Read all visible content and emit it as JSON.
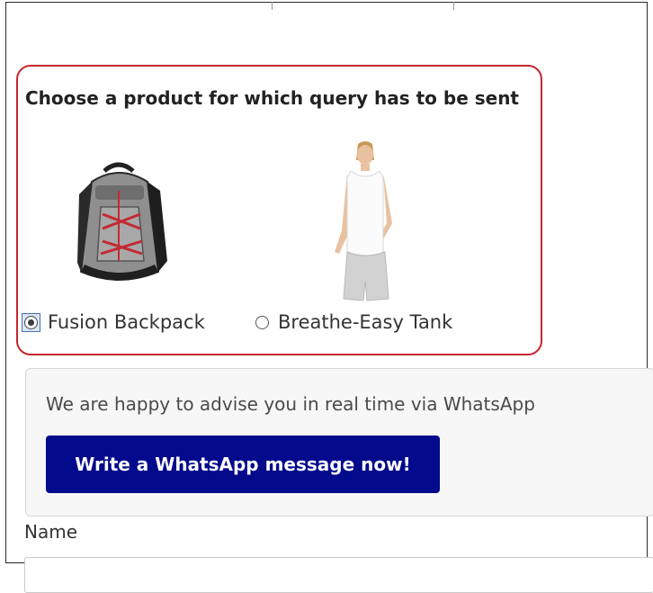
{
  "product_selector": {
    "heading": "Choose a product for which query has to be sent",
    "options": [
      {
        "label": "Fusion Backpack",
        "selected": true,
        "image": "backpack-image"
      },
      {
        "label": "Breathe-Easy Tank",
        "selected": false,
        "image": "tank-top-model-image"
      }
    ],
    "highlight_color": "#c8262f"
  },
  "whatsapp": {
    "text": "We are happy to advise you in real time via WhatsApp",
    "button_label": "Write a WhatsApp message now!",
    "button_color": "#030a8c"
  },
  "form": {
    "name_label": "Name"
  }
}
